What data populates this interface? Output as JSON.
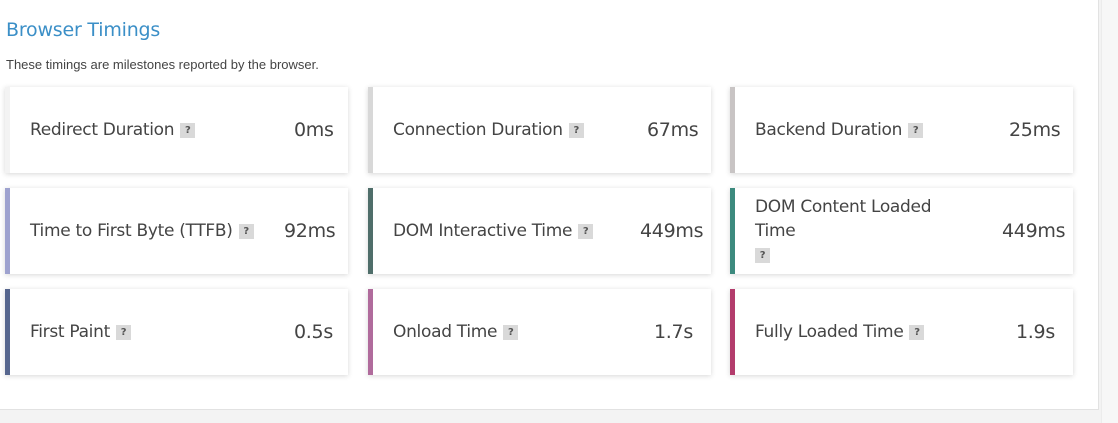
{
  "section": {
    "title": "Browser Timings",
    "description": "These timings are milestones reported by the browser."
  },
  "help_glyph": "?",
  "timings": [
    {
      "label": "Redirect Duration",
      "value": "0ms",
      "color": "#f3f3f3"
    },
    {
      "label": "Connection Duration",
      "value": "67ms",
      "color": "#d8d8d8"
    },
    {
      "label": "Backend Duration",
      "value": "25ms",
      "color": "#c8c4c4"
    },
    {
      "label": "Time to First Byte (TTFB)",
      "value": "92ms",
      "color": "#9ea2cf"
    },
    {
      "label": "DOM Interactive Time",
      "value": "449ms",
      "color": "#4f6e6a"
    },
    {
      "label": "DOM Content Loaded Time",
      "value": "449ms",
      "color": "#3c8a7e"
    },
    {
      "label": "First Paint",
      "value": "0.5s",
      "color": "#56668e"
    },
    {
      "label": "Onload Time",
      "value": "1.7s",
      "color": "#b06b9c"
    },
    {
      "label": "Fully Loaded Time",
      "value": "1.9s",
      "color": "#b33c6c"
    }
  ]
}
